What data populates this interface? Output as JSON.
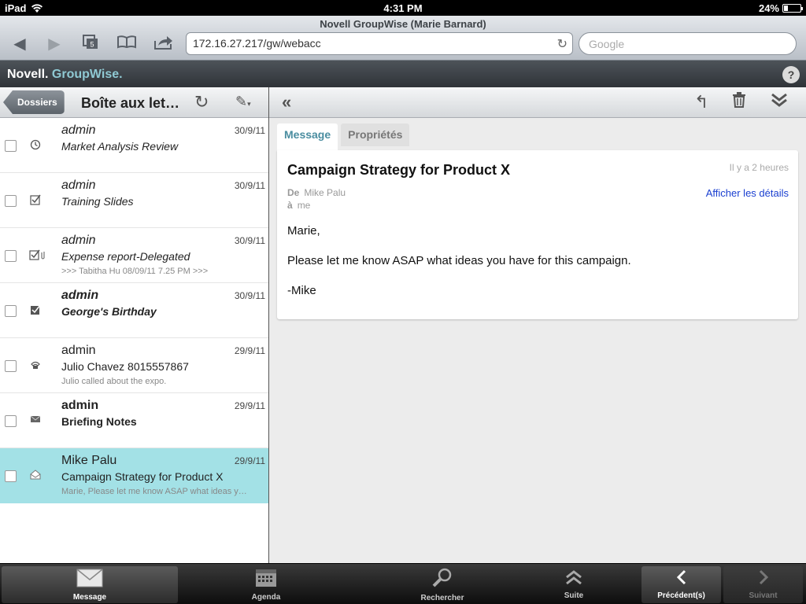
{
  "status": {
    "device": "iPad",
    "time": "4:31 PM",
    "battery": "24%",
    "battery_level": 0.24
  },
  "browser": {
    "title": "Novell GroupWise (Marie Barnard)",
    "url": "172.16.27.217/gw/webacc",
    "search_placeholder": "Google",
    "tabs_count": "5"
  },
  "app": {
    "brand_novell": "Novell.",
    "brand_gw": "GroupWise.",
    "help": "?"
  },
  "left_toolbar": {
    "back_label": "Dossiers",
    "folder_title": "Boîte aux let…"
  },
  "messages": [
    {
      "sender": "admin",
      "subject": "Market Analysis Review",
      "preview": "",
      "date": "30/9/11",
      "icon": "clock-icon",
      "style": "italic"
    },
    {
      "sender": "admin",
      "subject": "Training Slides",
      "preview": "",
      "date": "30/9/11",
      "icon": "task-check-icon",
      "style": "italic"
    },
    {
      "sender": "admin",
      "subject": "Expense report-Delegated",
      "preview": ">>> Tabitha Hu 08/09/11 7.25 PM >>>",
      "date": "30/9/11",
      "icon": "task-attachment-icon",
      "style": "italic"
    },
    {
      "sender": "admin",
      "subject": "George's Birthday",
      "preview": "",
      "date": "30/9/11",
      "icon": "task-done-icon",
      "style": "bold-italic"
    },
    {
      "sender": "admin",
      "subject": "Julio Chavez  8015557867",
      "preview": "Julio called about the expo.",
      "date": "29/9/11",
      "icon": "phone-icon",
      "style": "normal"
    },
    {
      "sender": "admin",
      "subject": "Briefing Notes",
      "preview": "",
      "date": "29/9/11",
      "icon": "envelope-icon",
      "style": "bold"
    },
    {
      "sender": "Mike Palu",
      "subject": "Campaign Strategy for Product X",
      "preview": "Marie, Please let me know ASAP what ideas y…",
      "date": "29/9/11",
      "icon": "open-envelope-icon",
      "style": "normal",
      "selected": true
    }
  ],
  "detail": {
    "tab_message": "Message",
    "tab_properties": "Propriétés",
    "subject": "Campaign Strategy for Product X",
    "time": "Il y a 2 heures",
    "from_label": "De",
    "from": "Mike Palu",
    "to_label": "à",
    "to": "me",
    "details_link": "Afficher les détails",
    "body": [
      "Marie,",
      "Please let me know ASAP what ideas you have for this campaign.",
      "-Mike"
    ]
  },
  "tabbar": {
    "message": "Message",
    "agenda": "Agenda",
    "search": "Rechercher",
    "more": "Suite",
    "prev": "Précédent(s)",
    "next": "Suivant"
  }
}
